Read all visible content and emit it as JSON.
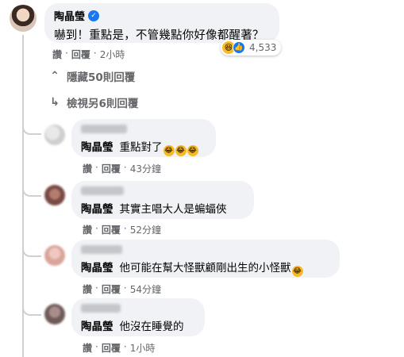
{
  "main_comment": {
    "author": "陶晶瑩",
    "text": "嚇到！重點是，不管幾點你好像都醒著？",
    "reaction_count": "4,533",
    "like_label": "讚",
    "reply_label": "回覆",
    "time": "2小時"
  },
  "hide_replies_label": "隱藏50則回覆",
  "view_more_label": "檢視另6則回覆",
  "replies": [
    {
      "mention": "陶晶瑩",
      "text": "重點對了",
      "like_label": "讚",
      "reply_label": "回覆",
      "time": "43分鐘"
    },
    {
      "mention": "陶晶瑩",
      "text": "其實主唱大人是蝙蝠俠",
      "like_label": "讚",
      "reply_label": "回覆",
      "time": "52分鐘"
    },
    {
      "mention": "陶晶瑩",
      "text": "他可能在幫大怪獸顧剛出生的小怪獸",
      "like_label": "讚",
      "reply_label": "回覆",
      "time": "54分鐘"
    },
    {
      "mention": "陶晶瑩",
      "text": "他沒在睡覺的",
      "like_label": "讚",
      "reply_label": "回覆",
      "time": "1小時"
    }
  ],
  "colors": {
    "bubble": "#f0f2f5",
    "meta_text": "#65676b",
    "verified": "#1877f2",
    "haha": "#f7b928"
  },
  "icons": [
    "verified-badge-icon",
    "haha-reaction-icon",
    "like-reaction-icon",
    "collapse-caret-icon",
    "reply-arrow-icon",
    "laughing-emoji-icon"
  ]
}
